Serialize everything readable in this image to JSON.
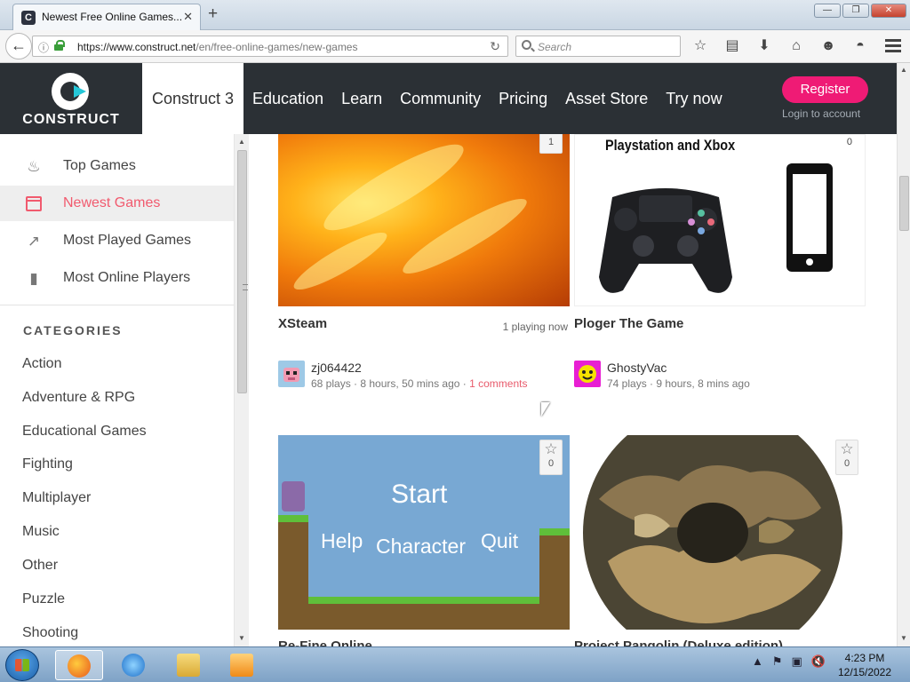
{
  "browser": {
    "tab_title": "Newest Free Online Games...",
    "tab_favicon_letter": "C",
    "url_host": "https://www.construct.net",
    "url_path": "/en/free-online-games/new-games",
    "search_placeholder": "Search"
  },
  "site": {
    "logo_text": "CONSTRUCT",
    "nav_active": "Construct 3",
    "nav_items": [
      "Education",
      "Learn",
      "Community",
      "Pricing",
      "Asset Store",
      "Try now"
    ],
    "register_label": "Register",
    "login_label": "Login to account"
  },
  "sidebar": {
    "items": [
      {
        "label": "Top Games",
        "icon": "fire-icon"
      },
      {
        "label": "Newest Games",
        "icon": "calendar-icon"
      },
      {
        "label": "Most Played Games",
        "icon": "trending-icon"
      },
      {
        "label": "Most Online Players",
        "icon": "usb-icon"
      }
    ],
    "categories_title": "CATEGORIES",
    "categories": [
      "Action",
      "Adventure & RPG",
      "Educational Games",
      "Fighting",
      "Multiplayer",
      "Music",
      "Other",
      "Puzzle",
      "Shooting"
    ]
  },
  "games": [
    {
      "title": "XSteam",
      "playing_now": "1 playing now",
      "favorites": "1",
      "author": "zj064422",
      "plays": "68 plays",
      "time": "8 hours, 50 mins ago",
      "comments": "1 comments"
    },
    {
      "title": "Ploger The Game",
      "image_caption": "Playstation and Xbox",
      "favorites": "0",
      "author": "GhostyVac",
      "plays": "74 plays",
      "time": "9 hours, 8 mins ago"
    },
    {
      "title": "Re-Fine Online",
      "favorites": "0",
      "image_words": [
        "Start",
        "Help",
        "Character",
        "Quit"
      ]
    },
    {
      "title": "Project Pangolin (Deluxe edition)",
      "favorites": "0"
    }
  ],
  "taskbar": {
    "time": "4:23 PM",
    "date": "12/15/2022"
  }
}
